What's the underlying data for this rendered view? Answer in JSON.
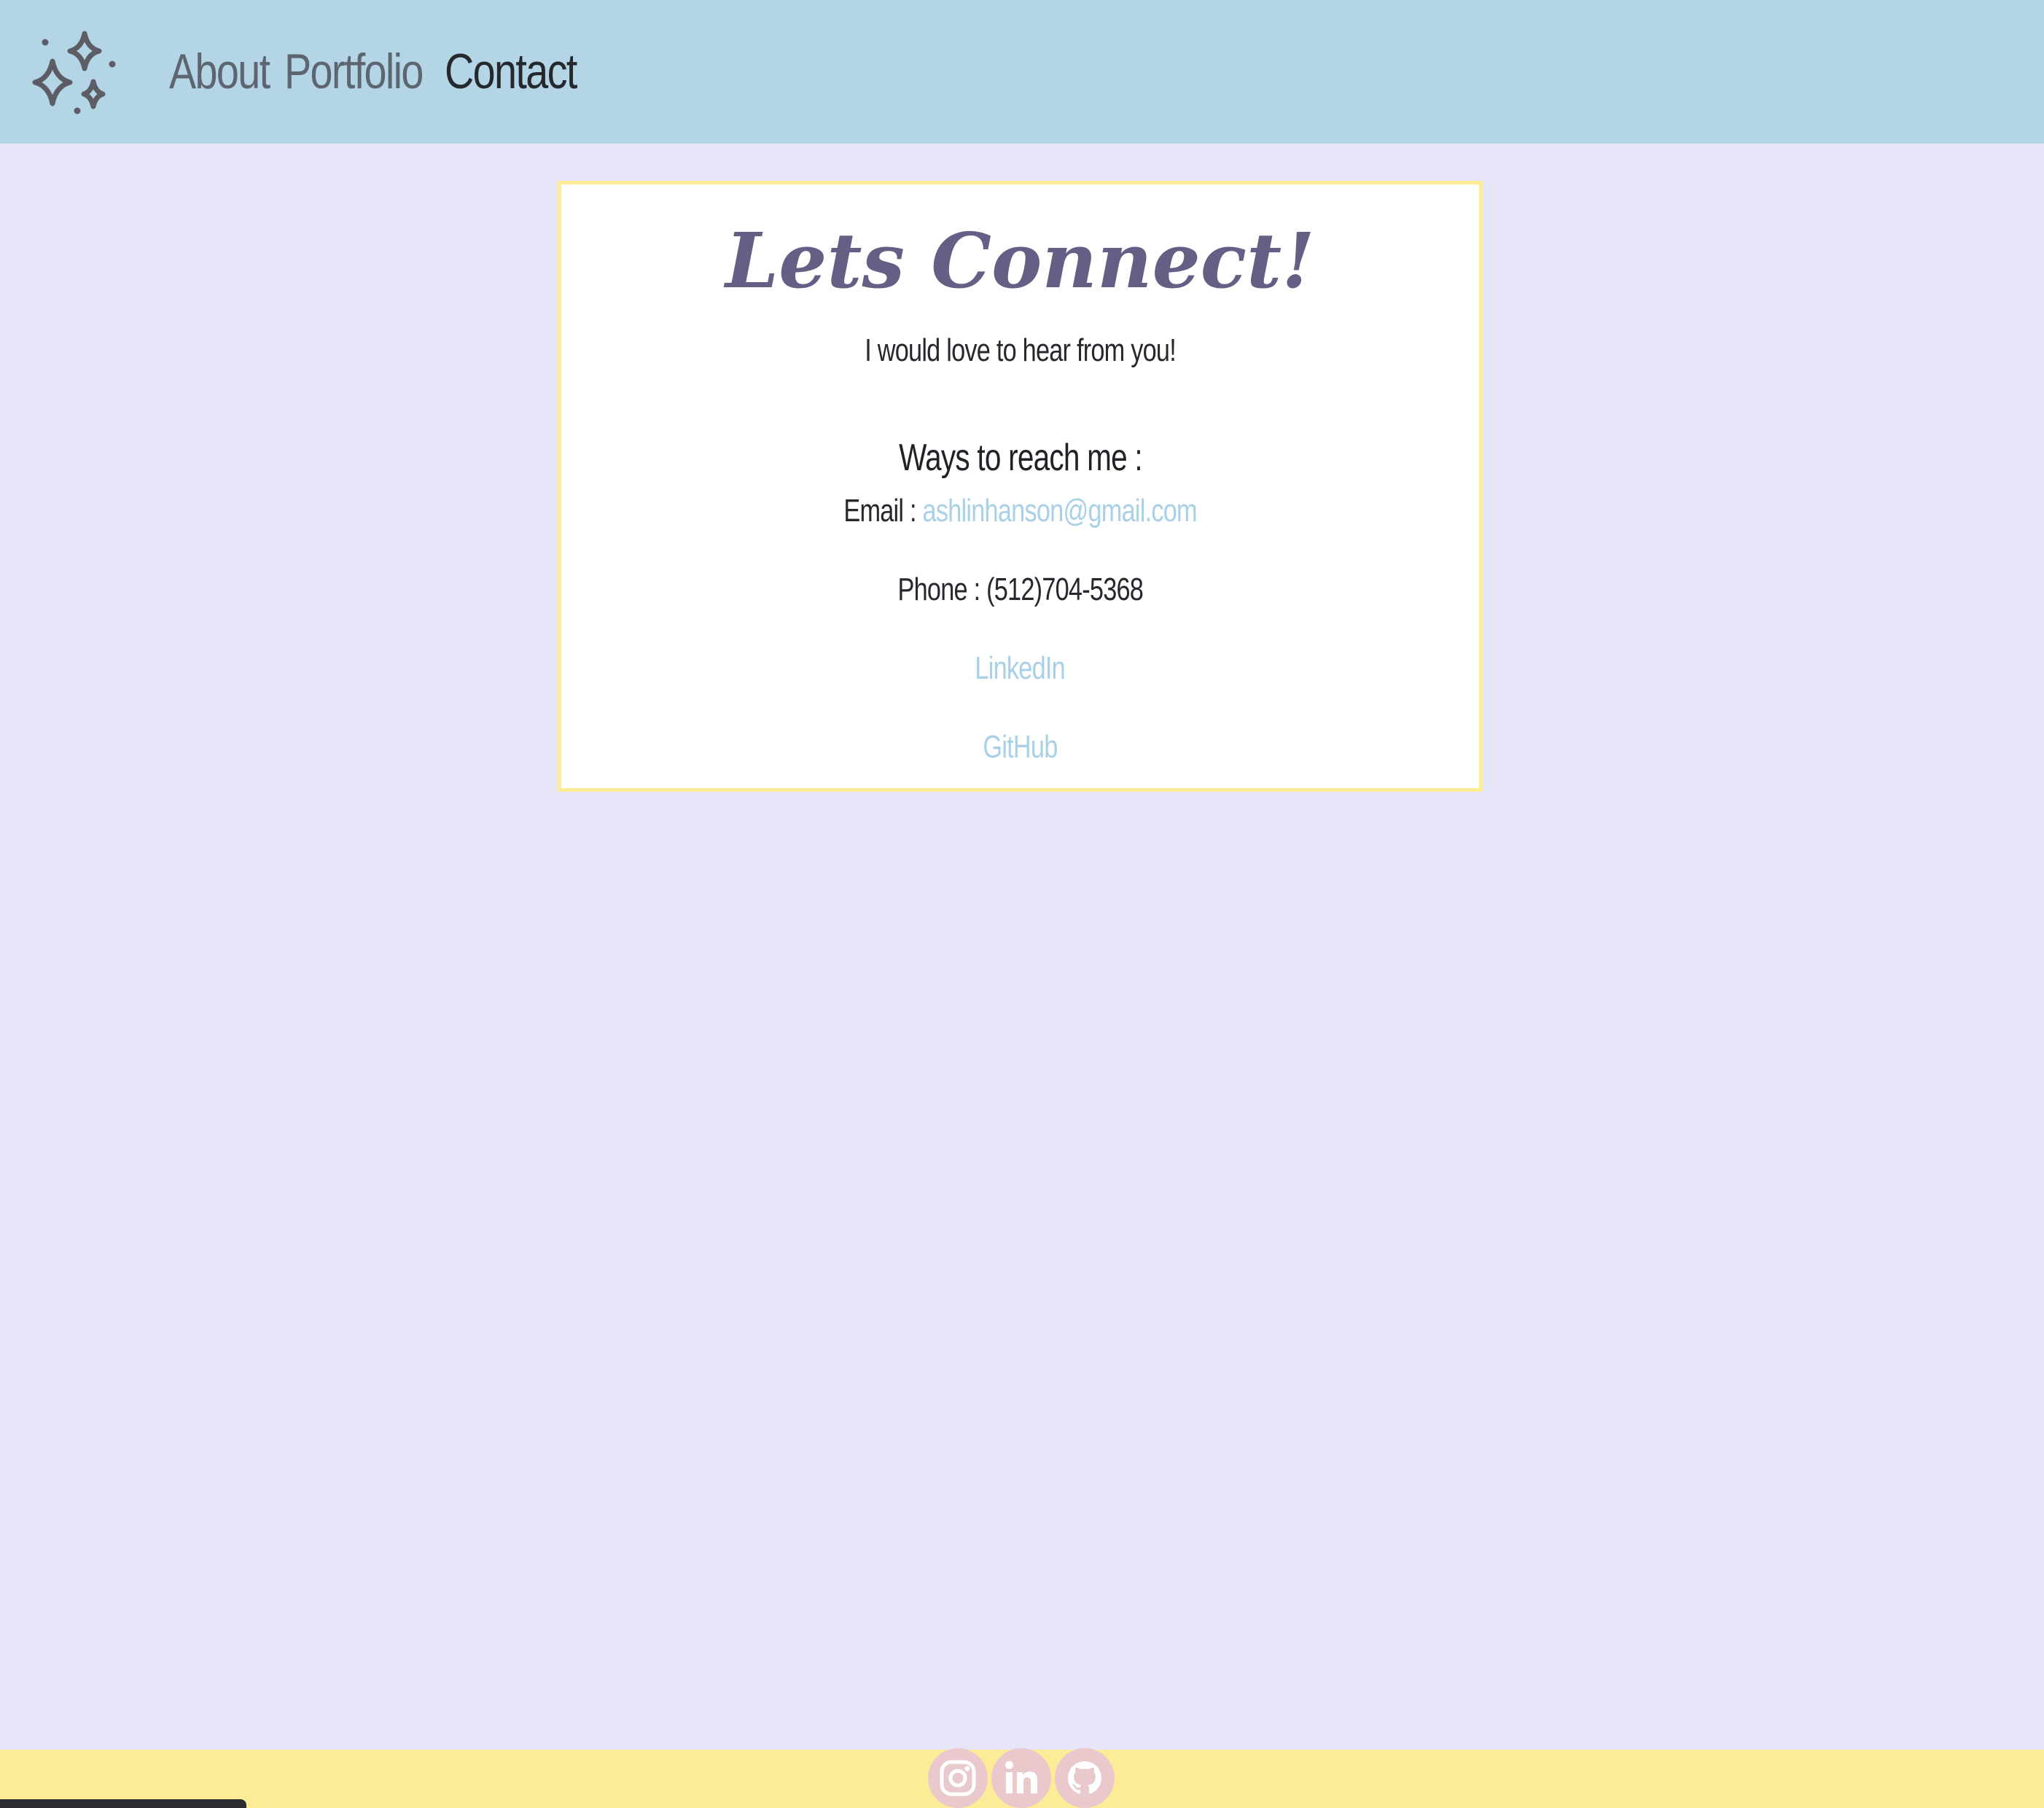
{
  "nav": {
    "logo_icon": "sparkles-icon",
    "items": [
      {
        "label": "About",
        "active": false
      },
      {
        "label": "Portfolio",
        "active": false
      },
      {
        "label": "Contact",
        "active": true
      }
    ]
  },
  "contact": {
    "title": "Lets Connect!",
    "subtitle": "I would love to hear from you!",
    "ways_heading": "Ways to reach me :",
    "email_label": "Email :",
    "email_value": "ashlinhanson@gmail.com",
    "phone_label": "Phone :",
    "phone_value": "(512)704-5368",
    "linkedin_label": "LinkedIn",
    "github_label": "GitHub"
  },
  "footer": {
    "icons": [
      "instagram-icon",
      "linkedin-icon",
      "github-icon"
    ]
  },
  "colors": {
    "navbar_bg": "#b3d5e6",
    "page_bg": "#e6e6f8",
    "card_border": "#fdec93",
    "title": "#665f85",
    "link": "#a8d0e6",
    "footer_bg": "#fcec98",
    "social_bg": "#eac9cc"
  }
}
